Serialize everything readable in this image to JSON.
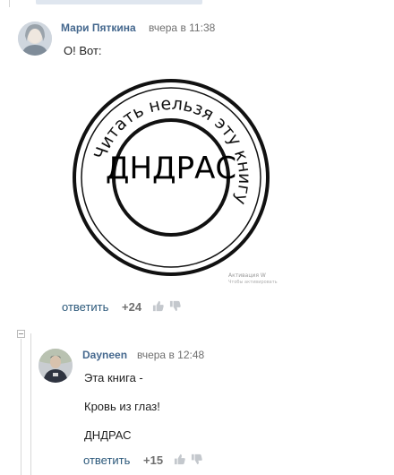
{
  "comment1": {
    "author": "Мари Пяткина",
    "date": "вчера в 11:38",
    "text": "О! Вот:",
    "image": {
      "center_text": "ДНДРАС",
      "ring_text": "Читать нельзя эту книгу",
      "watermark_line1": "Активация W",
      "watermark_line2": "Чтобы активировать"
    },
    "reply_label": "ответить",
    "rating": "+24"
  },
  "comment2": {
    "author": "Dayneen",
    "date": "вчера в 12:48",
    "lines": [
      "Эта книга -",
      "Кровь из глаз!",
      "ДНДРАС"
    ],
    "reply_label": "ответить",
    "rating": "+15"
  },
  "colors": {
    "author": "#45688e",
    "link": "#2b587a",
    "muted": "#6f6f6f"
  },
  "icons": [
    "like-icon",
    "dislike-icon",
    "collapse-thread-icon"
  ]
}
